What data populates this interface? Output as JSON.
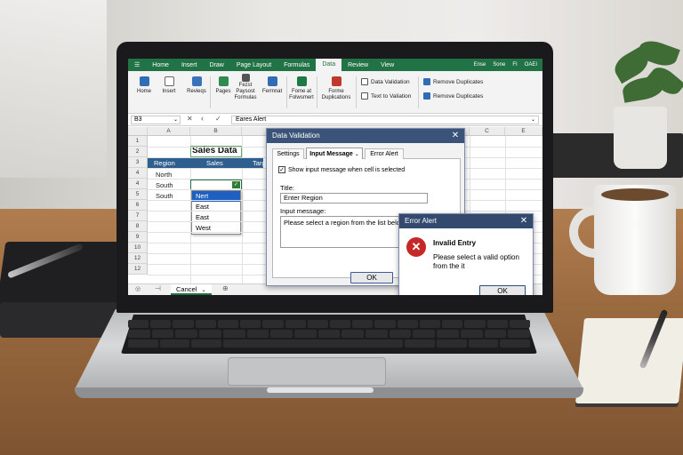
{
  "excel": {
    "ribbon_tabs": [
      "Home",
      "Insert",
      "Draw",
      "Page Layout",
      "Formulas",
      "Data",
      "Review",
      "View"
    ],
    "active_tab": "Data",
    "tabs_right": [
      "Ense",
      "Sone",
      "FI",
      "OAEI"
    ],
    "ribbon_buttons": {
      "home": "Home",
      "insert": "Insert",
      "review": "Revieqs",
      "pages": "Pages",
      "forms_1": "Fezst",
      "forms_2": "Paysost",
      "forms_3": "Formulas",
      "format": "Fermnat",
      "sort_1": "Fome at",
      "sort_2": "Folwsmert",
      "remove_dup_big_1": "Forme",
      "remove_dup_big_2": "Duplications",
      "data_validation": "Data Validation",
      "text_to_validation": "Text to Valiation",
      "remove_dup_1": "Remove Duplicates",
      "remove_dup_2": "Remove Duplicates"
    },
    "name_box": "B3",
    "formula_text": "Eares Alert",
    "columns": [
      "A",
      "B",
      "C",
      "E"
    ],
    "rows": [
      "1",
      "2",
      "3",
      "4",
      "4",
      "5",
      "6",
      "7",
      "8",
      "9",
      "10",
      "12",
      "12"
    ],
    "cells": {
      "title": "Sales Data",
      "header_region": "Region",
      "header_sales": "Sales",
      "header_target": "Targ",
      "north": "North",
      "south_1": "South",
      "south_2": "South"
    },
    "dropdown_options": [
      "Nert",
      "East",
      "East",
      "West"
    ],
    "sheet_tab": "Cancel",
    "sheet_tab_chevron": "⌄"
  },
  "data_validation_dialog": {
    "title": "Data Validation",
    "tabs": [
      "Settings",
      "Input Message",
      "Error Alert"
    ],
    "active_tab": "Input Message",
    "checkbox_label": "Show input message when cell is selected",
    "checkbox_checked": true,
    "title_label": "Title:",
    "title_value": "Enter Region",
    "message_label": "Input message:",
    "message_value": "Please select a region from the list below.",
    "ok": "OK"
  },
  "error_alert_dialog": {
    "title": "Error Alert",
    "heading": "Invalid Entry",
    "message": "Please select a valid option from the it",
    "ok": "OK"
  },
  "colors": {
    "excel_green": "#217346",
    "header_blue": "#2f5f8f",
    "dialog_title": "#3b5378",
    "error_red": "#c62828",
    "selection_blue": "#1f5fbf"
  }
}
